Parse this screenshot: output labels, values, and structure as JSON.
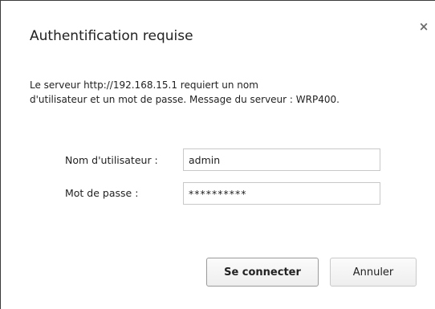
{
  "dialog": {
    "title": "Authentification requise",
    "close_glyph": "×",
    "message_line1": "Le serveur http://192.168.15.1 requiert un nom",
    "message_line2": "d'utilisateur et un mot de passe. Message du serveur : WRP400."
  },
  "form": {
    "username_label": "Nom d'utilisateur :",
    "username_value": "admin",
    "password_label": "Mot de passe :",
    "password_value": "**********"
  },
  "buttons": {
    "connect_label": "Se connecter",
    "cancel_label": "Annuler"
  },
  "icons": {
    "close": "close-icon"
  }
}
